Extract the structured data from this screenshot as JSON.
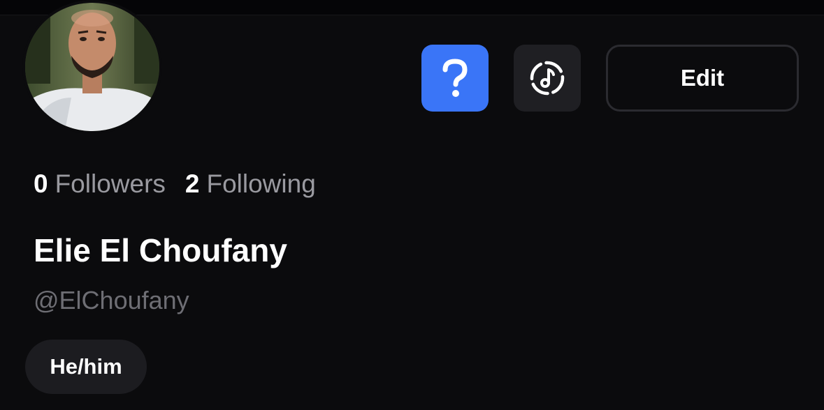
{
  "profile": {
    "avatar_icon": "profile-photo",
    "display_name": "Elie El Choufany",
    "handle": "@ElChoufany",
    "pronouns": "He/him"
  },
  "actions": {
    "help_icon": "question-mark-icon",
    "music_icon": "music-note-icon",
    "edit_label": "Edit"
  },
  "stats": {
    "followers_count": "0",
    "followers_label": "Followers",
    "following_count": "2",
    "following_label": "Following"
  },
  "colors": {
    "background": "#0b0b0d",
    "accent": "#3a75f7",
    "button_bg": "#1f1f23",
    "muted_text": "#9a9aa0"
  }
}
